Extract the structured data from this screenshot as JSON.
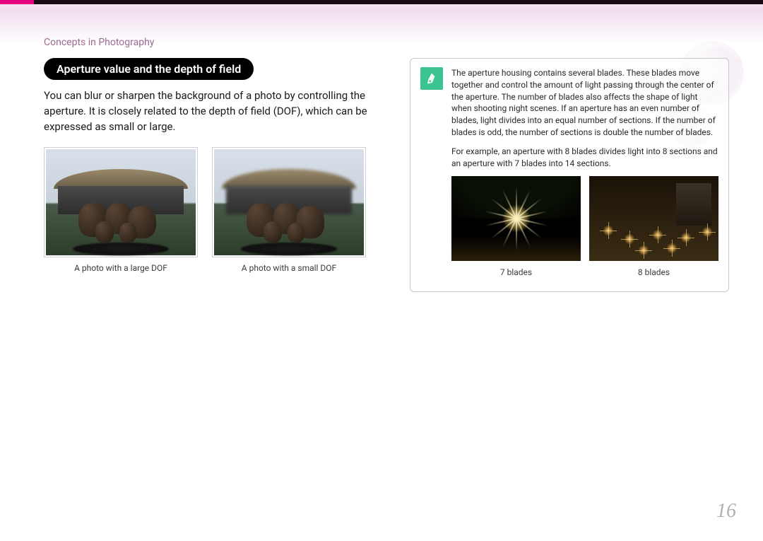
{
  "breadcrumb": "Concepts in Photography",
  "heading": "Aperture value and the depth of field",
  "body": "You can blur or sharpen the background of a photo by controlling the aperture. It is closely related to the depth of field (DOF), which can be expressed as small or large.",
  "photos": {
    "large_dof_caption": "A photo with a large DOF",
    "small_dof_caption": "A photo with a small DOF"
  },
  "info": {
    "para1": "The aperture housing contains several blades. These blades move together and control the amount of light passing through the center of the aperture. The number of blades also affects the shape of light when shooting night scenes. If an aperture has an even number of blades, light divides into an equal number of sections. If the number of blades is odd, the number of sections is double the number of blades.",
    "para2": "For example, an aperture with 8 blades divides light into 8 sections and an aperture with 7 blades into 14 sections.",
    "caption_7": "7 blades",
    "caption_8": "8 blades"
  },
  "page_number": "16"
}
